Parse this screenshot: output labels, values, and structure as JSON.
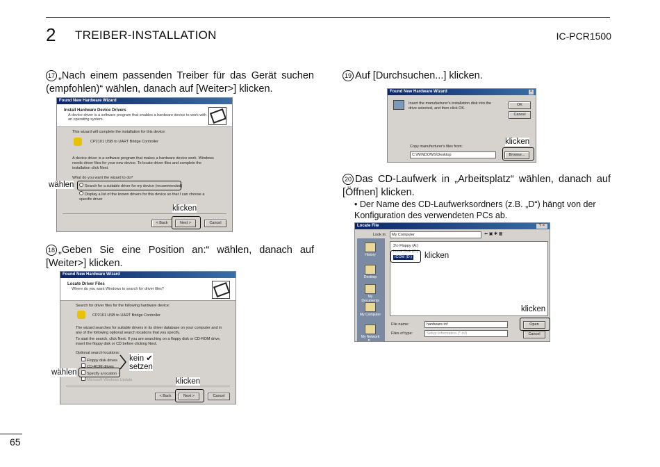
{
  "header": {
    "chapter": "2",
    "title": "TREIBER-INSTALLATION",
    "model": "IC-PCR1500"
  },
  "page_number": "65",
  "step17": {
    "num": "17",
    "text": "„Nach einem passenden Treiber für das Gerät suchen (empfohlen)“ wählen, danach auf [Weiter>] klicken.",
    "dialog": {
      "titlebar": "Found New Hardware Wizard",
      "heading": "Install Hardware Device Drivers",
      "subheading": "A device driver is a software program that enables a hardware device to work with an operating system.",
      "line1": "This wizard will complete the installation for this device:",
      "device": "CP2101 USB to UART Bridge Controller",
      "line2": "A device driver is a software program that makes a hardware device work. Windows needs driver files for your new device. To locate driver files and complete the installation click Next.",
      "question": "What do you want the wizard to do?",
      "opt1": "Search for a suitable driver for my device (recommended)",
      "opt2": "Display a list of the known drivers for this device so that I can choose a specific driver",
      "back": "< Back",
      "next": "Next >",
      "cancel": "Cancel"
    },
    "label_select": "wählen",
    "label_click": "klicken"
  },
  "step18": {
    "num": "18",
    "text": "„Geben Sie eine Position an:“ wählen, danach auf [Weiter>] klicken.",
    "dialog": {
      "titlebar": "Found New Hardware Wizard",
      "heading": "Locate Driver Files",
      "subheading": "Where do you want Windows to search for driver files?",
      "line1": "Search for driver files for the following hardware device:",
      "device": "CP2101 USB to UART Bridge Controller",
      "line2": "The wizard searches for suitable drivers in its driver database on your computer and in any of the following optional search locations that you specify.",
      "line3": "To start the search, click Next. If you are searching on a floppy disk or CD-ROM drive, insert the floppy disk or CD before clicking Next.",
      "optional": "Optional search locations:",
      "opt1": "Floppy disk drives",
      "opt2": "CD-ROM drives",
      "opt3": "Specify a location",
      "opt4": "Microsoft Windows Update",
      "back": "< Back",
      "next": "Next >",
      "cancel": "Cancel"
    },
    "label_no": "kein ✔",
    "label_set": "setzen",
    "label_select": "wählen",
    "label_click": "klicken"
  },
  "step19": {
    "num": "19",
    "text": "Auf [Durchsuchen...] klicken.",
    "dialog": {
      "titlebar": "Found New Hardware Wizard",
      "msg": "Insert the manufacturer's installation disk into the drive selected, and then click OK.",
      "ok": "OK",
      "cancel": "Cancel",
      "copy_label": "Copy manufacturer's files from:",
      "path": "C:\\WINDOWS\\Desktop",
      "browse": "Browse..."
    },
    "label_click": "klicken"
  },
  "step20": {
    "num": "20",
    "text": "Das CD-Laufwerk in „Arbeitsplatz“ wählen, danach auf [Öffnen] klicken.",
    "bullet": "Der Name des CD-Laufwerksordners (z.B. „D“) hängt von der Konfiguration des verwendeten PCs ab.",
    "dialog": {
      "titlebar": "Locate File",
      "look_in_label": "Look in:",
      "look_in": "My Computer",
      "item1": "3½ Floppy (A:)",
      "item2": "Local Disk (C:)",
      "item3": "ICOM (D:)",
      "sidebar": [
        "History",
        "Desktop",
        "My Documents",
        "My Computer",
        "My Network P..."
      ],
      "filename_label": "File name:",
      "filename": "hardware.inf",
      "filetype_label": "Files of type:",
      "filetype": "Setup Information (*.inf)",
      "open": "Open",
      "cancel": "Cancel"
    },
    "label_click_item": "klicken",
    "label_click_open": "klicken"
  }
}
